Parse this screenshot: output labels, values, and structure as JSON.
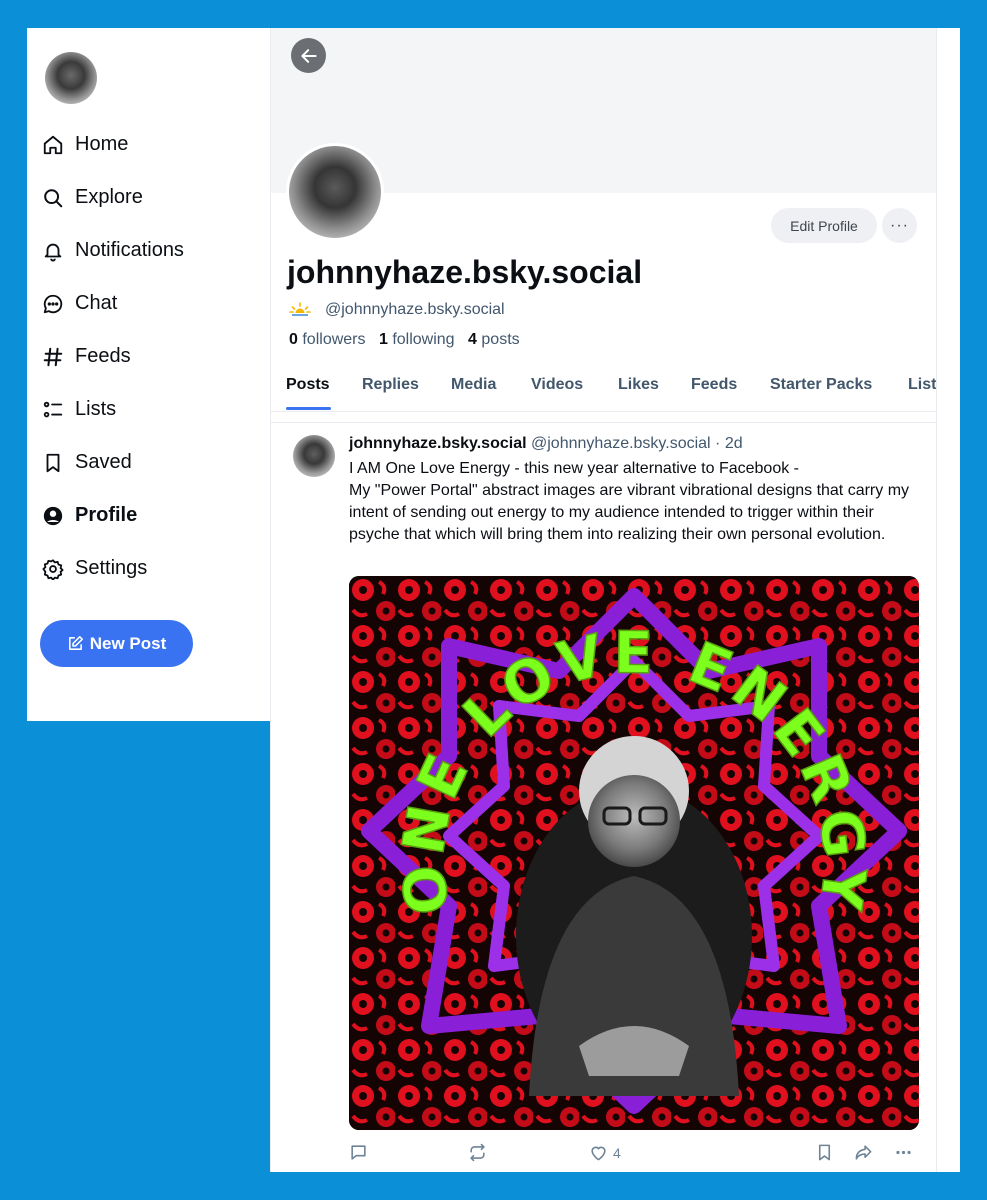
{
  "sidebar": {
    "items": [
      {
        "label": "Home",
        "icon": "home-icon"
      },
      {
        "label": "Explore",
        "icon": "search-icon"
      },
      {
        "label": "Notifications",
        "icon": "bell-icon"
      },
      {
        "label": "Chat",
        "icon": "chat-icon"
      },
      {
        "label": "Feeds",
        "icon": "hashtag-icon"
      },
      {
        "label": "Lists",
        "icon": "list-icon"
      },
      {
        "label": "Saved",
        "icon": "bookmark-icon"
      },
      {
        "label": "Profile",
        "icon": "profile-icon",
        "active": true
      },
      {
        "label": "Settings",
        "icon": "gear-icon"
      }
    ],
    "new_post_label": "New Post"
  },
  "profile": {
    "display_name": "johnnyhaze.bsky.social",
    "handle": "@johnnyhaze.bsky.social",
    "edit_label": "Edit Profile",
    "more_label": "···",
    "followers_count": "0",
    "followers_label": "followers",
    "following_count": "1",
    "following_label": "following",
    "posts_count": "4",
    "posts_label": "posts"
  },
  "tabs": [
    {
      "label": "Posts",
      "active": true
    },
    {
      "label": "Replies"
    },
    {
      "label": "Media"
    },
    {
      "label": "Videos"
    },
    {
      "label": "Likes"
    },
    {
      "label": "Feeds"
    },
    {
      "label": "Starter Packs"
    },
    {
      "label": "Lists"
    }
  ],
  "post": {
    "author_name": "johnnyhaze.bsky.social",
    "author_handle": "@johnnyhaze.bsky.social",
    "separator": "·",
    "time": "2d",
    "text_line1": "I AM One Love Energy - this new year alternative to Facebook -",
    "text_line2": "My \"Power Portal\" abstract images are vibrant vibrational designs that carry my intent of sending out energy to my audience intended to trigger within their psyche that which will bring them into realizing their own personal evolution.",
    "image_text": "ONE LOVE ENERGY",
    "like_count": "4"
  },
  "colors": {
    "accent": "#3a73f2",
    "page_background": "#0b8fd6",
    "image_green": "#7dff1e",
    "image_purple": "#8a1fd8",
    "image_red": "#e0101e"
  }
}
